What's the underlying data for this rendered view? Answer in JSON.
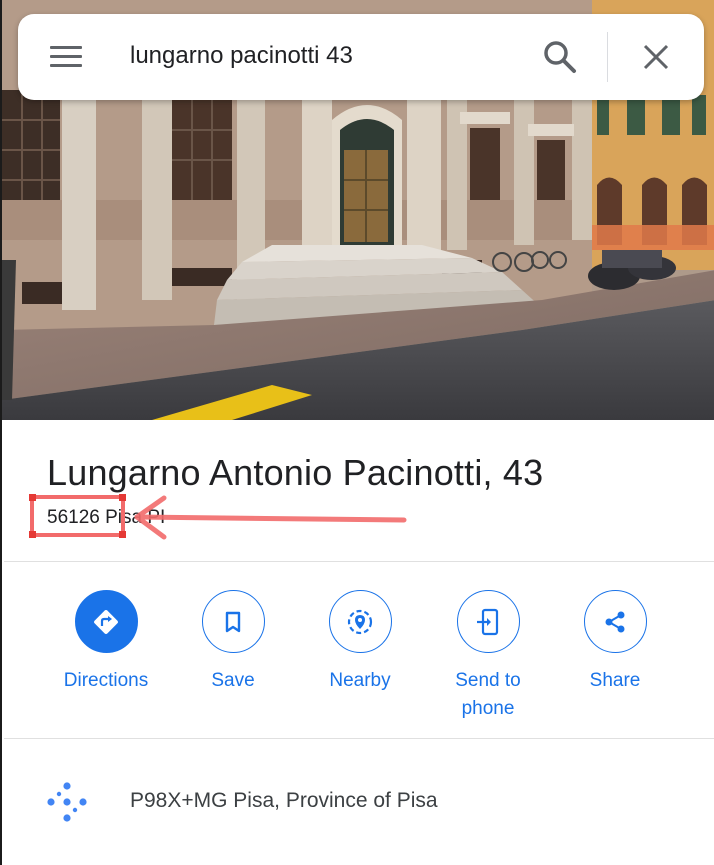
{
  "search": {
    "query": "lungarno pacinotti 43"
  },
  "place": {
    "title": "Lungarno Antonio Pacinotti, 43",
    "postal_code": "56126",
    "locality": " Pisa PI"
  },
  "actions": [
    {
      "label": "Directions",
      "icon": "directions-icon"
    },
    {
      "label": "Save",
      "icon": "bookmark-icon"
    },
    {
      "label": "Nearby",
      "icon": "nearby-icon"
    },
    {
      "label": "Send to phone",
      "icon": "send-to-phone-icon"
    },
    {
      "label": "Share",
      "icon": "share-icon"
    }
  ],
  "plus_code": {
    "text": "P98X+MG Pisa, Province of Pisa",
    "icon": "plus-code-icon"
  },
  "colors": {
    "accent": "#1a73e8",
    "annotation": "#f26b6b"
  }
}
